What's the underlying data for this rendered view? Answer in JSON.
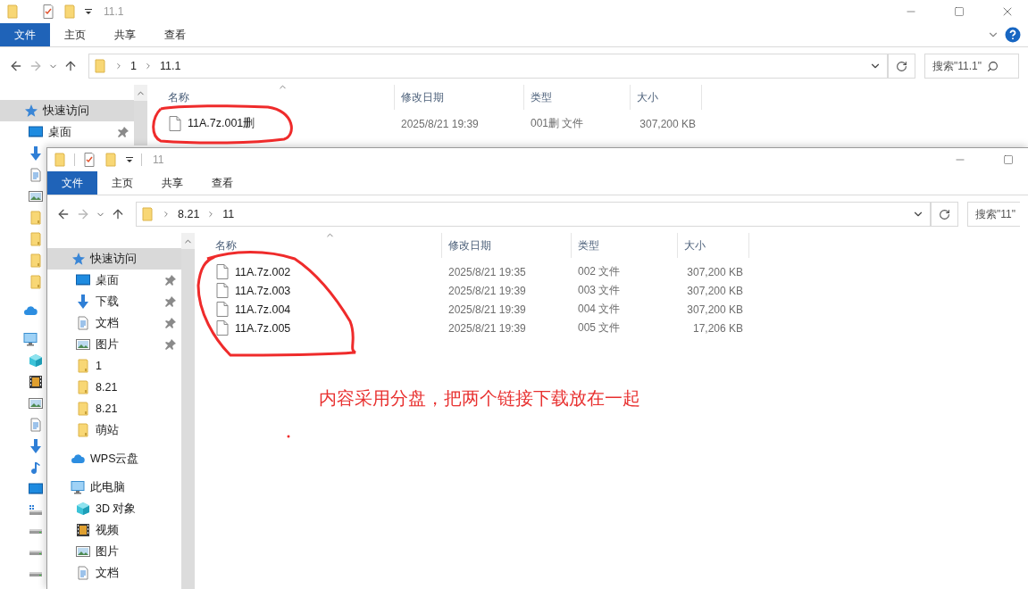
{
  "back_window": {
    "title": "11.1",
    "ribbon_tabs": [
      {
        "label": "文件",
        "kind": "file-menu"
      },
      {
        "label": "主页",
        "kind": "tab"
      },
      {
        "label": "共享",
        "kind": "tab"
      },
      {
        "label": "查看",
        "kind": "tab"
      }
    ],
    "path": [
      "1",
      "11.1"
    ],
    "search": {
      "placeholder": "搜索\"11.1\""
    },
    "nav": [
      {
        "label": "快速访问",
        "kind": "star",
        "selected": true,
        "children": [
          {
            "label": "桌面",
            "kind": "desktop",
            "pinned": true
          },
          {
            "kind": "download"
          },
          {
            "kind": "doc"
          },
          {
            "kind": "picture"
          },
          {
            "kind": "folder"
          },
          {
            "kind": "folder"
          },
          {
            "kind": "folder"
          },
          {
            "kind": "folder"
          }
        ]
      },
      {
        "kind": "cloud"
      },
      {
        "kind": "pc",
        "children": [
          {
            "kind": "cube"
          },
          {
            "kind": "video"
          },
          {
            "kind": "picture"
          },
          {
            "kind": "doc"
          },
          {
            "kind": "download"
          },
          {
            "kind": "music"
          },
          {
            "kind": "desktop"
          },
          {
            "kind": "drive-win"
          },
          {
            "kind": "drive"
          },
          {
            "kind": "drive"
          },
          {
            "kind": "drive"
          }
        ]
      }
    ],
    "columns": [
      {
        "label": "名称",
        "sorted": true
      },
      {
        "label": "修改日期",
        "sorted": false
      },
      {
        "label": "类型",
        "sorted": false
      },
      {
        "label": "大小",
        "sorted": false
      }
    ],
    "files": [
      {
        "name": "11A.7z.001删",
        "modified": "2025/8/21 19:39",
        "type": "001删 文件",
        "size": "307,200 KB"
      }
    ]
  },
  "front_window": {
    "title": "11",
    "ribbon_tabs": [
      {
        "label": "文件",
        "kind": "file-menu"
      },
      {
        "label": "主页",
        "kind": "tab"
      },
      {
        "label": "共享",
        "kind": "tab"
      },
      {
        "label": "查看",
        "kind": "tab"
      }
    ],
    "path": [
      "8.21",
      "11"
    ],
    "search": {
      "placeholder": "搜索\"11\""
    },
    "nav": [
      {
        "label": "快速访问",
        "kind": "star",
        "selected": true,
        "children": [
          {
            "label": "桌面",
            "kind": "desktop",
            "pinned": true
          },
          {
            "label": "下载",
            "kind": "download",
            "pinned": true
          },
          {
            "label": "文档",
            "kind": "doc",
            "pinned": true
          },
          {
            "label": "图片",
            "kind": "picture",
            "pinned": true
          },
          {
            "label": "1",
            "kind": "folder",
            "pinned": false
          },
          {
            "label": "8.21",
            "kind": "folder",
            "pinned": false
          },
          {
            "label": "8.21",
            "kind": "folder",
            "pinned": false
          },
          {
            "label": "萌站",
            "kind": "folder",
            "pinned": false
          }
        ]
      },
      {
        "label": "WPS云盘",
        "kind": "cloud"
      },
      {
        "label": "此电脑",
        "kind": "pc",
        "children": [
          {
            "label": "3D 对象",
            "kind": "cube"
          },
          {
            "label": "视频",
            "kind": "video"
          },
          {
            "label": "图片",
            "kind": "picture"
          },
          {
            "label": "文档",
            "kind": "doc"
          }
        ]
      }
    ],
    "columns": [
      {
        "label": "名称",
        "sorted": true
      },
      {
        "label": "修改日期",
        "sorted": false
      },
      {
        "label": "类型",
        "sorted": false
      },
      {
        "label": "大小",
        "sorted": false
      }
    ],
    "files": [
      {
        "name": "11A.7z.002",
        "modified": "2025/8/21 19:35",
        "type": "002 文件",
        "size": "307,200 KB"
      },
      {
        "name": "11A.7z.003",
        "modified": "2025/8/21 19:39",
        "type": "003 文件",
        "size": "307,200 KB"
      },
      {
        "name": "11A.7z.004",
        "modified": "2025/8/21 19:39",
        "type": "004 文件",
        "size": "307,200 KB"
      },
      {
        "name": "11A.7z.005",
        "modified": "2025/8/21 19:39",
        "type": "005 文件",
        "size": "17,206 KB"
      }
    ]
  },
  "annotation": {
    "note": "内容采用分盘，把两个链接下载放在一起"
  }
}
